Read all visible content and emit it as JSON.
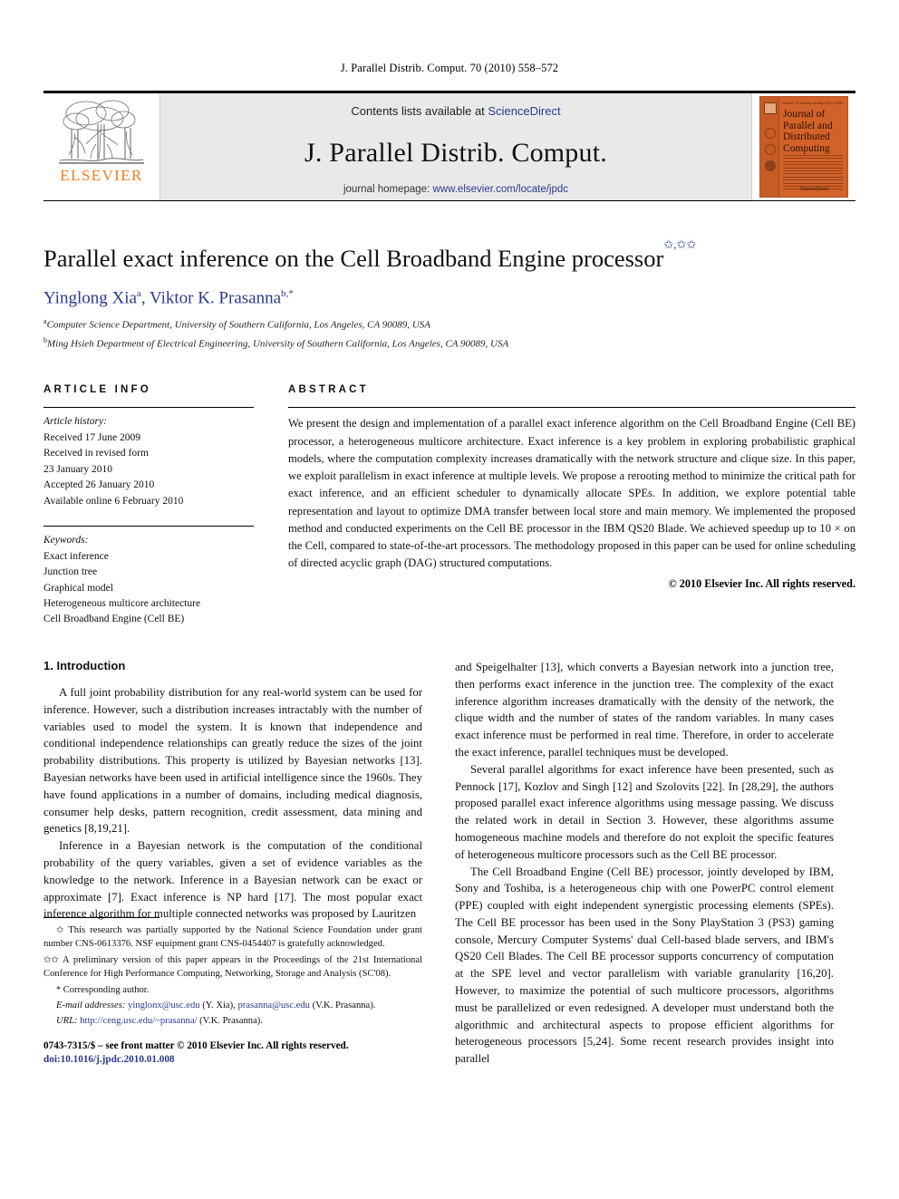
{
  "running_head": "J. Parallel Distrib. Comput. 70 (2010) 558–572",
  "masthead": {
    "publisher_logo_text": "ELSEVIER",
    "contents_prefix": "Contents lists available at ",
    "sciencedirect": "ScienceDirect",
    "journal_name": "J. Parallel Distrib. Comput.",
    "homepage_prefix": "journal homepage: ",
    "homepage_url": "www.elsevier.com/locate/jpdc",
    "cover": {
      "top_meta": "Volume 70   Number 5   May 2010   ISSN 0743-7315",
      "title_lines": [
        "Journal of",
        "Parallel and",
        "Distributed",
        "Computing"
      ],
      "footer": "Available online at\nScienceDirect\nwww.sciencedirect.com"
    }
  },
  "article": {
    "title": "Parallel exact inference on the Cell Broadband Engine processor",
    "title_footnote_marks": "✩,✩✩",
    "authors_html": "Yinglong Xia a, Viktor K. Prasanna b,*",
    "author_1": "Yinglong Xia",
    "author_1_mark": "a",
    "author_2": "Viktor K. Prasanna",
    "author_2_mark": "b,",
    "author_2_corresp": "*",
    "affiliations": [
      {
        "mark": "a",
        "text": "Computer Science Department, University of Southern California, Los Angeles, CA 90089, USA"
      },
      {
        "mark": "b",
        "text": "Ming Hsieh Department of Electrical Engineering, University of Southern California, Los Angeles, CA 90089, USA"
      }
    ]
  },
  "info": {
    "heading": "ARTICLE INFO",
    "history_label": "Article history:",
    "history": [
      "Received 17 June 2009",
      "Received in revised form",
      "23 January 2010",
      "Accepted 26 January 2010",
      "Available online 6 February 2010"
    ],
    "keywords_label": "Keywords:",
    "keywords": [
      "Exact inference",
      "Junction tree",
      "Graphical model",
      "Heterogeneous multicore architecture",
      "Cell Broadband Engine (Cell BE)"
    ]
  },
  "abstract": {
    "heading": "ABSTRACT",
    "text": "We present the design and implementation of a parallel exact inference algorithm on the Cell Broadband Engine (Cell BE) processor, a heterogeneous multicore architecture. Exact inference is a key problem in exploring probabilistic graphical models, where the computation complexity increases dramatically with the network structure and clique size. In this paper, we exploit parallelism in exact inference at multiple levels. We propose a rerooting method to minimize the critical path for exact inference, and an efficient scheduler to dynamically allocate SPEs. In addition, we explore potential table representation and layout to optimize DMA transfer between local store and main memory. We implemented the proposed method and conducted experiments on the Cell BE processor in the IBM QS20 Blade. We achieved speedup up to 10 × on the Cell, compared to state-of-the-art processors. The methodology proposed in this paper can be used for online scheduling of directed acyclic graph (DAG) structured computations.",
    "copyright": "© 2010 Elsevier Inc. All rights reserved."
  },
  "body": {
    "section_title": "1. Introduction",
    "left_paragraphs": [
      "A full joint probability distribution for any real-world system can be used for inference. However, such a distribution increases intractably with the number of variables used to model the system. It is known that independence and conditional independence relationships can greatly reduce the sizes of the joint probability distributions. This property is utilized by Bayesian networks [13]. Bayesian networks have been used in artificial intelligence since the 1960s. They have found applications in a number of domains, including medical diagnosis, consumer help desks, pattern recognition, credit assessment, data mining and genetics [8,19,21].",
      "Inference in a Bayesian network is the computation of the conditional probability of the query variables, given a set of evidence variables as the knowledge to the network. Inference in a Bayesian network can be exact or approximate [7]. Exact inference is NP hard [17]. The most popular exact inference algorithm for multiple connected networks was proposed by Lauritzen"
    ],
    "right_paragraphs": [
      "and Speigelhalter [13], which converts a Bayesian network into a junction tree, then performs exact inference in the junction tree. The complexity of the exact inference algorithm increases dramatically with the density of the network, the clique width and the number of states of the random variables. In many cases exact inference must be performed in real time. Therefore, in order to accelerate the exact inference, parallel techniques must be developed.",
      "Several parallel algorithms for exact inference have been presented, such as Pennock [17], Kozlov and Singh [12] and Szolovits [22]. In [28,29], the authors proposed parallel exact inference algorithms using message passing. We discuss the related work in detail in Section 3. However, these algorithms assume homogeneous machine models and therefore do not exploit the specific features of heterogeneous multicore processors such as the Cell BE processor.",
      "The Cell Broadband Engine (Cell BE) processor, jointly developed by IBM, Sony and Toshiba, is a heterogeneous chip with one PowerPC control element (PPE) coupled with eight independent synergistic processing elements (SPEs). The Cell BE processor has been used in the Sony PlayStation 3 (PS3) gaming console, Mercury Computer Systems' dual Cell-based blade servers, and IBM's QS20 Cell Blades. The Cell BE processor supports concurrency of computation at the SPE level and vector parallelism with variable granularity [16,20]. However, to maximize the potential of such multicore processors, algorithms must be parallelized or even redesigned. A developer must understand both the algorithmic and architectural aspects to propose efficient algorithms for heterogeneous processors [5,24]. Some recent research provides insight into parallel"
    ]
  },
  "footnotes": {
    "star1_mark": "✩",
    "star1": "This research was partially supported by the National Science Foundation under grant number CNS-0613376. NSF equipment grant CNS-0454407 is gratefully acknowledged.",
    "star2_mark": "✩✩",
    "star2": "A preliminary version of this paper appears in the Proceedings of the 21st International Conference for High Performance Computing, Networking, Storage and Analysis (SC'08).",
    "corresp_mark": "*",
    "corresp": "Corresponding author.",
    "email_label": "E-mail addresses:",
    "email_1": "yinglonx@usc.edu",
    "email_1_who": "(Y. Xia),",
    "email_2": "prasanna@usc.edu",
    "email_2_who": "(V.K. Prasanna).",
    "url_label": "URL:",
    "url": "http://ceng.usc.edu/~prasanna/",
    "url_who": "(V.K. Prasanna).",
    "issn_line": "0743-7315/$ – see front matter © 2010 Elsevier Inc. All rights reserved.",
    "doi_label": "doi:",
    "doi": "10.1016/j.jpdc.2010.01.008"
  }
}
